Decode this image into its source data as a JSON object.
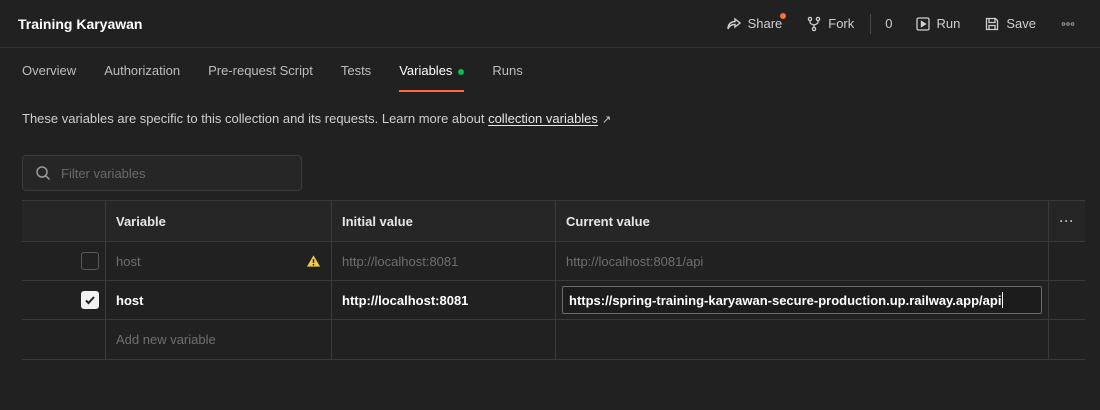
{
  "header": {
    "title": "Training Karyawan",
    "share_label": "Share",
    "fork_label": "Fork",
    "fork_count": "0",
    "run_label": "Run",
    "save_label": "Save",
    "accent_color": "#ff6c37"
  },
  "tabs": [
    {
      "label": "Overview"
    },
    {
      "label": "Authorization"
    },
    {
      "label": "Pre-request Script"
    },
    {
      "label": "Tests"
    },
    {
      "label": "Variables",
      "active": true
    },
    {
      "label": "Runs"
    }
  ],
  "description": {
    "text": "These variables are specific to this collection and its requests. Learn more about ",
    "link_text": "collection variables",
    "link_arrow": "↗"
  },
  "filter": {
    "placeholder": "Filter variables",
    "value": ""
  },
  "table": {
    "columns": [
      "Variable",
      "Initial value",
      "Current value"
    ],
    "rows": [
      {
        "checked": false,
        "variable": "host",
        "warning": true,
        "initial": "http://localhost:8081",
        "current": "http://localhost:8081/api"
      },
      {
        "checked": true,
        "variable": "host",
        "warning": false,
        "initial": "http://localhost:8081",
        "current": "https://spring-training-karyawan-secure-production.up.railway.app/api"
      }
    ],
    "add_placeholder": "Add new variable"
  }
}
